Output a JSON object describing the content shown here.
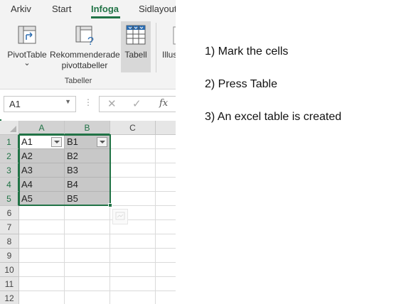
{
  "ribbon": {
    "tabs": [
      {
        "label": "Arkiv",
        "active": false
      },
      {
        "label": "Start",
        "active": false
      },
      {
        "label": "Infoga",
        "active": true
      },
      {
        "label": "Sidlayout",
        "active": false
      }
    ],
    "buttons": {
      "pivottable": {
        "label": "PivotTable",
        "dropdown": "⌄"
      },
      "recommended": {
        "line1": "Rekommenderade",
        "line2": "pivottabeller"
      },
      "tabell": {
        "label": "Tabell"
      },
      "illustrations": {
        "label": "Illus"
      }
    },
    "group_label": "Tabeller"
  },
  "formula_bar": {
    "name_box": "A1",
    "cancel_symbol": "✕",
    "enter_symbol": "✓",
    "fx_label": "fx"
  },
  "sheet": {
    "columns": [
      "A",
      "B",
      "C"
    ],
    "rows": [
      "1",
      "2",
      "3",
      "4",
      "5",
      "6",
      "7",
      "8",
      "9",
      "10",
      "11",
      "12"
    ],
    "table_cells": [
      [
        "A1",
        "B1"
      ],
      [
        "A2",
        "B2"
      ],
      [
        "A3",
        "B3"
      ],
      [
        "A4",
        "B4"
      ],
      [
        "A5",
        "B5"
      ]
    ]
  },
  "instructions": [
    "1) Mark the cells",
    "2) Press Table",
    "3) An excel table is created"
  ],
  "colors": {
    "accent": "#217346",
    "ribbon_bg": "#f3f3f3",
    "table_fill": "#c8c8c8"
  }
}
